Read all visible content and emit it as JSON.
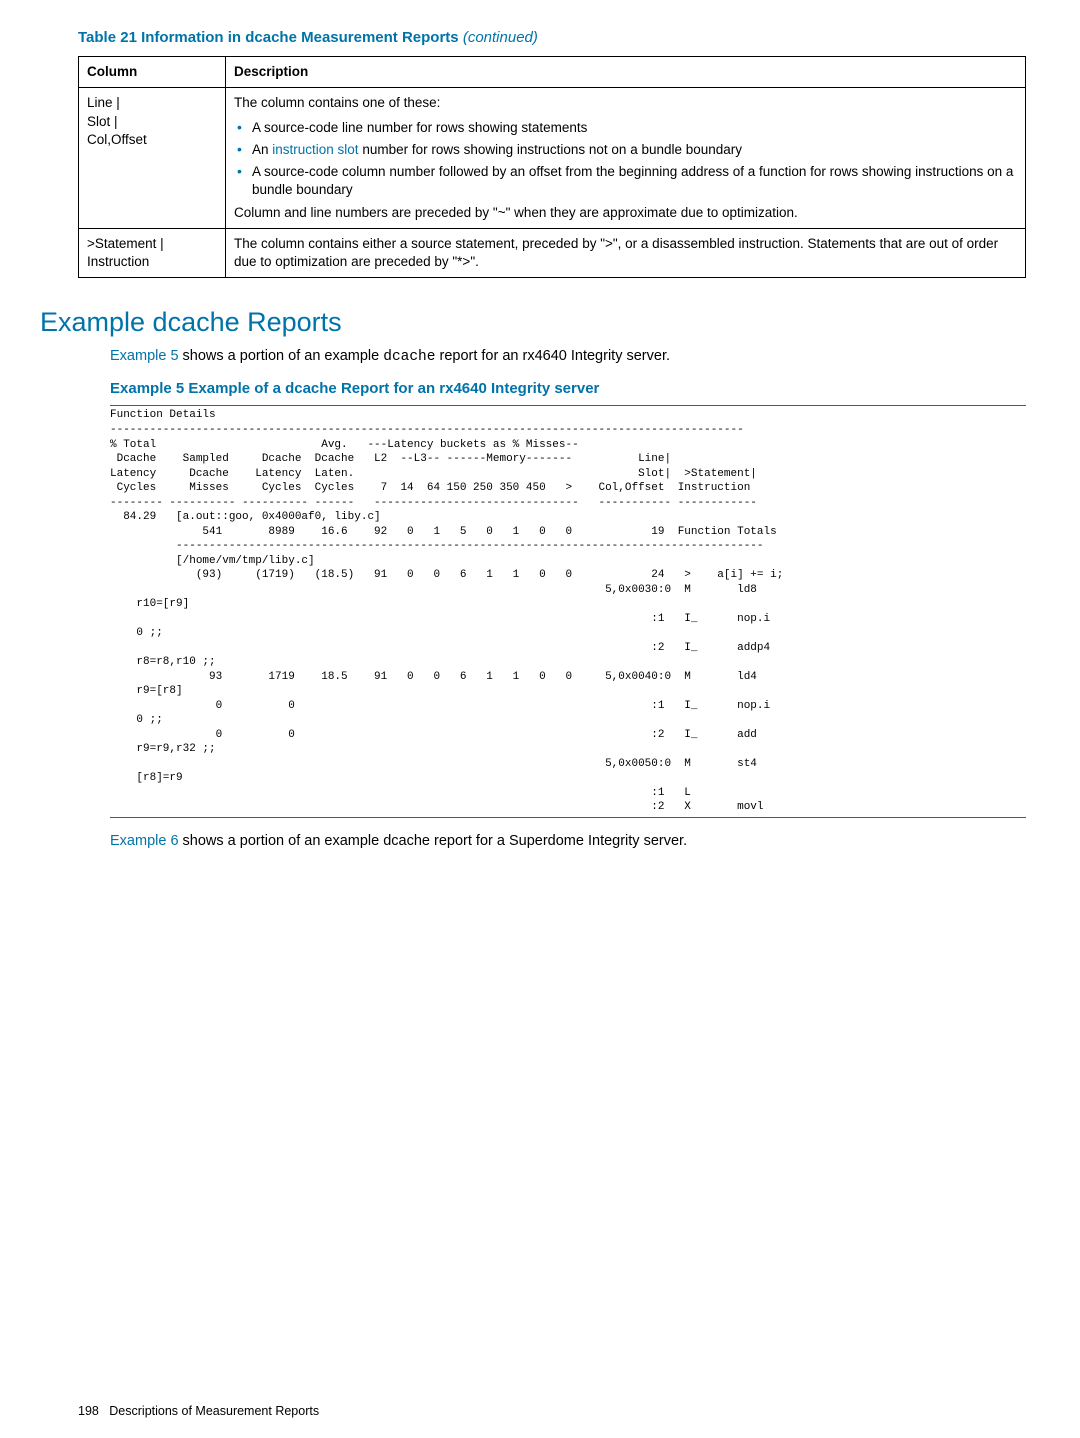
{
  "table21": {
    "caption": "Table 21 Information in dcache Measurement Reports",
    "caption_tail": " (continued)",
    "col_header_1": "Column",
    "col_header_2": "Description",
    "row1_col1_l1": "Line |",
    "row1_col1_l2": "Slot |",
    "row1_col1_l3": "Col,Offset",
    "row1_intro": "The column contains one of these:",
    "row1_b1": "A source-code line number for rows showing statements",
    "row1_b2a": "An ",
    "row1_b2link": "instruction slot",
    "row1_b2b": " number for rows showing instructions not on a bundle boundary",
    "row1_b3": "A source-code column number followed by an offset from the beginning address of a function for rows showing instructions on a bundle boundary",
    "row1_outro": "Column and line numbers are preceded by \"~\" when they are approximate due to optimization.",
    "row2_col1_l1": ">Statement |",
    "row2_col1_l2": "Instruction",
    "row2_desc": "The column contains either a source statement, preceded by \">\", or a disassembled instruction. Statements that are out of order due to optimization are preceded by \"*>\"."
  },
  "section_heading": "Example dcache Reports",
  "para1_a": "Example 5",
  "para1_b": " shows a portion of an example ",
  "para1_mono": "dcache",
  "para1_c": " report for an rx4640 Integrity server.",
  "ex5_caption": "Example 5 Example of a dcache Report for an rx4640 Integrity server",
  "ex5_pre": "Function Details\n------------------------------------------------------------------------------------------------\n% Total                         Avg.   ---Latency buckets as % Misses--\n Dcache    Sampled     Dcache  Dcache   L2  --L3-- ------Memory-------          Line|\nLatency     Dcache    Latency  Laten.                                           Slot|  >Statement|\n Cycles     Misses     Cycles  Cycles    7  14  64 150 250 350 450   >    Col,Offset  Instruction\n-------- ---------- ---------- ------   -------------------------------   ----------- ------------\n  84.29   [a.out::goo, 0x4000af0, liby.c]\n              541       8989    16.6    92   0   1   5   0   1   0   0            19  Function Totals\n          -----------------------------------------------------------------------------------------\n          [/home/vm/tmp/liby.c]\n             (93)     (1719)   (18.5)   91   0   0   6   1   1   0   0            24   >    a[i] += i;\n                                                                           5,0x0030:0  M       ld8\n    r10=[r9]\n                                                                                  :1   I_      nop.i\n    0 ;;\n                                                                                  :2   I_      addp4\n    r8=r8,r10 ;;\n               93       1719    18.5    91   0   0   6   1   1   0   0     5,0x0040:0  M       ld4\n    r9=[r8]\n                0          0                                                      :1   I_      nop.i\n    0 ;;\n                0          0                                                      :2   I_      add\n    r9=r9,r32 ;;\n                                                                           5,0x0050:0  M       st4\n    [r8]=r9\n                                                                                  :1   L\n                                                                                  :2   X       movl",
  "para2_a": "Example 6",
  "para2_b": " shows a portion of an example dcache report for a Superdome Integrity server.",
  "footer_page": "198",
  "footer_text": "Descriptions of Measurement Reports"
}
